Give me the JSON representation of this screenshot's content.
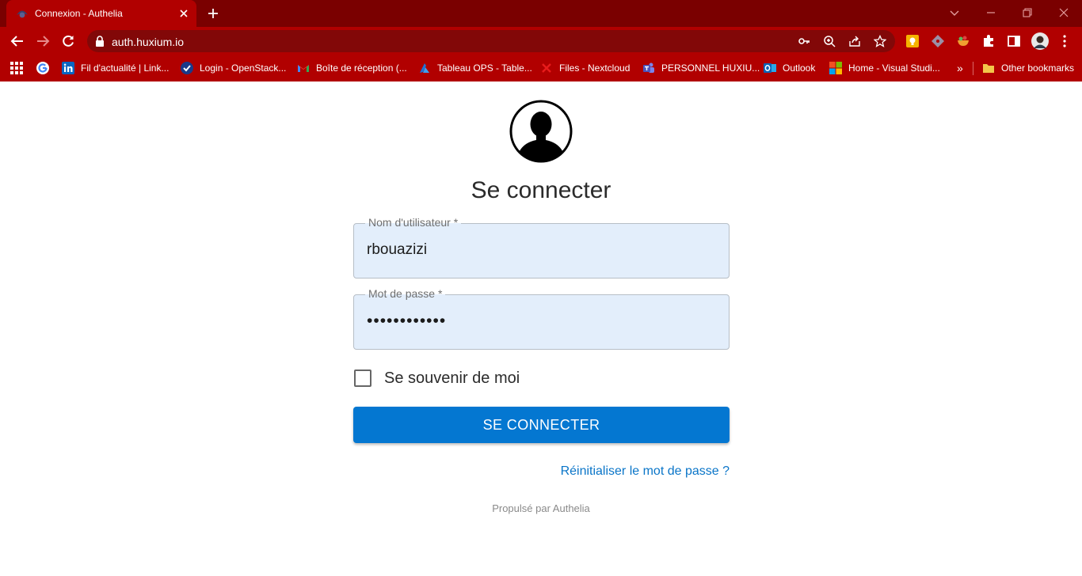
{
  "tab": {
    "title": "Connexion - Authelia"
  },
  "address_bar": {
    "url": "auth.huxium.io"
  },
  "bookmarks": [
    {
      "label": "",
      "icon": "google-icon"
    },
    {
      "label": "Fil d'actualité | Link...",
      "icon": "linkedin-icon"
    },
    {
      "label": "Login - OpenStack...",
      "icon": "openstack-icon"
    },
    {
      "label": "Boîte de réception (...",
      "icon": "gmail-icon"
    },
    {
      "label": "Tableau OPS - Table...",
      "icon": "azure-devops-icon"
    },
    {
      "label": "Files - Nextcloud",
      "icon": "nextcloud-icon"
    },
    {
      "label": "PERSONNEL HUXIU...",
      "icon": "teams-icon"
    },
    {
      "label": "Outlook",
      "icon": "outlook-icon"
    },
    {
      "label": "Home - Visual Studi...",
      "icon": "microsoft-icon"
    },
    {
      "label": "»",
      "icon": "chevron-double-icon"
    },
    {
      "label": "Other bookmarks",
      "icon": "folder-icon"
    }
  ],
  "login": {
    "heading": "Se connecter",
    "username_label": "Nom d'utilisateur *",
    "username_value": "rbouazizi",
    "password_label": "Mot de passe *",
    "password_value": "••••••••••••",
    "remember_label": "Se souvenir de moi",
    "remember_checked": false,
    "submit_label": "SE CONNECTER",
    "reset_link": "Réinitialiser le mot de passe ?",
    "powered_by": "Propulsé par Authelia"
  },
  "colors": {
    "tabstrip": "#7a0000",
    "toolbar": "#b10000",
    "primary_button": "#0477d1",
    "link": "#0a75c8",
    "input_fill": "#e3eefb"
  }
}
